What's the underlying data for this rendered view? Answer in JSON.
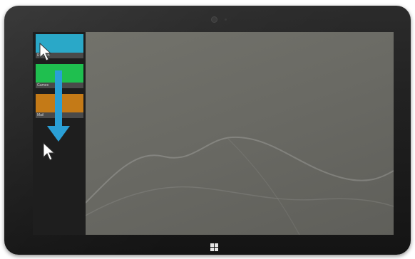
{
  "device": {
    "colors": {
      "bezel": "#1f1f1f",
      "desktop": "#6a6a64"
    }
  },
  "app_switcher": {
    "thumbnails": [
      {
        "caption": "Refresh",
        "color": "#2aa8c8"
      },
      {
        "caption": "Games",
        "color": "#1fbf4f"
      },
      {
        "caption": "Mail",
        "color": "#c47a17"
      }
    ]
  },
  "gesture": {
    "arrow_color": "#2a9fd6",
    "icons": [
      "swipe-down-arrow-icon",
      "mouse-pointer-icon"
    ]
  },
  "hardware": {
    "home_button_icon": "windows-logo-icon"
  }
}
